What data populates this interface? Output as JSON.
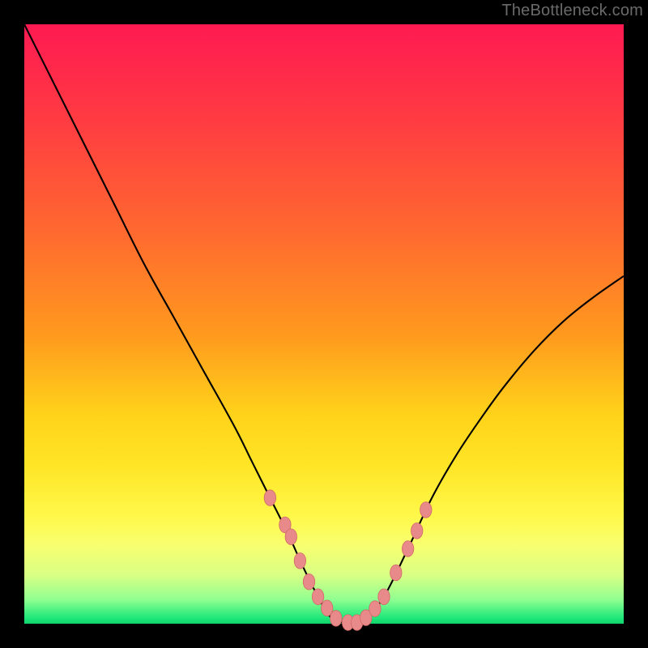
{
  "watermark": "TheBottleneck.com",
  "colors": {
    "curve": "#000000",
    "marker_fill": "#e98a8a",
    "marker_stroke": "#d26868",
    "gradient_top": "#ff1a52",
    "gradient_bottom": "#10d46a",
    "frame": "#000000"
  },
  "chart_data": {
    "type": "line",
    "title": "",
    "xlabel": "",
    "ylabel": "",
    "xlim": [
      0,
      100
    ],
    "ylim": [
      0,
      100
    ],
    "grid": false,
    "series": [
      {
        "name": "curve",
        "x": [
          0,
          5,
          10,
          15,
          20,
          25,
          30,
          35,
          38,
          41,
          44,
          46.5,
          49,
          51,
          53,
          55,
          57,
          60,
          64,
          68,
          72,
          76,
          80,
          85,
          90,
          95,
          100
        ],
        "y": [
          100,
          90,
          80,
          70,
          60,
          51,
          42,
          33,
          27,
          21,
          15,
          9.5,
          4.5,
          1.2,
          0.2,
          0.2,
          1.0,
          4.5,
          12.5,
          21,
          28,
          34,
          39.5,
          45.5,
          50.5,
          54.5,
          58
        ]
      }
    ],
    "markers": {
      "name": "dots",
      "color": "#e98a8a",
      "x": [
        41,
        43.5,
        44.5,
        46,
        47.5,
        49,
        50.5,
        52,
        54,
        55.5,
        57,
        58.5,
        60,
        62,
        64,
        65.5,
        67
      ],
      "y": [
        21,
        16.5,
        14.5,
        10.5,
        7.0,
        4.5,
        2.6,
        0.9,
        0.2,
        0.2,
        1.0,
        2.5,
        4.5,
        8.5,
        12.5,
        15.5,
        19.0
      ]
    }
  }
}
